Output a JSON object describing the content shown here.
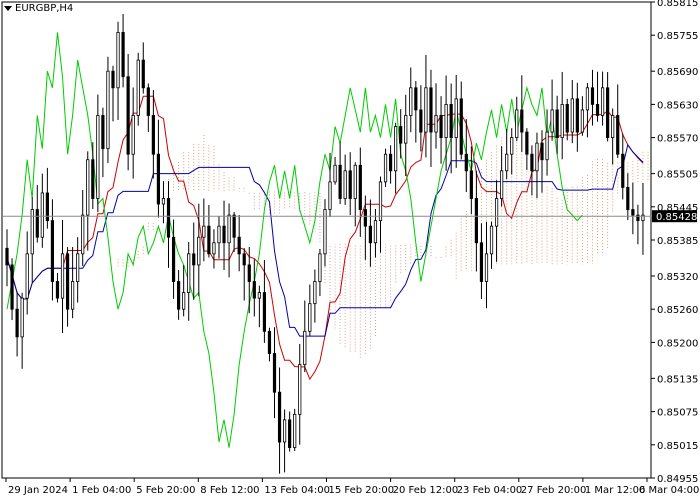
{
  "symbol_label": "EURGBP,H4",
  "icons": {
    "menu": "triangle-down-icon"
  },
  "colors": {
    "candle": "#000000",
    "tenkan": "#cc0000",
    "kijun": "#0000aa",
    "chikou": "#00cc00",
    "kumo_up": "#d9a0a0",
    "kumo_dn": "#e0a070",
    "price_line": "#8a8a8a"
  },
  "current_price": {
    "value": 0.85428,
    "label": "0.85428"
  },
  "chart_data": {
    "type": "candlestick",
    "ylim": [
      0.84955,
      0.85815
    ],
    "y_ticks": [
      "0.85815",
      "0.85755",
      "0.85690",
      "0.85630",
      "0.85570",
      "0.85505",
      "0.85445",
      "0.85385",
      "0.85320",
      "0.85260",
      "0.85200",
      "0.85135",
      "0.85075",
      "0.85015",
      "0.84955"
    ],
    "x_ticks": [
      "29 Jan 2024",
      "1 Feb 04:00",
      "5 Feb 20:00",
      "8 Feb 12:00",
      "13 Feb 04:00",
      "15 Feb 20:00",
      "20 Feb 12:00",
      "23 Feb 04:00",
      "27 Feb 20:00",
      "1 Mar 12:00",
      "6 Mar 04:00"
    ],
    "closes": [
      0.8534,
      0.8526,
      0.8521,
      0.8528,
      0.8536,
      0.8544,
      0.8539,
      0.8547,
      0.8542,
      0.8531,
      0.8528,
      0.8536,
      0.8526,
      0.8531,
      0.8536,
      0.8543,
      0.8553,
      0.8546,
      0.8561,
      0.8555,
      0.8569,
      0.8566,
      0.8576,
      0.8568,
      0.8554,
      0.8561,
      0.8571,
      0.8566,
      0.8561,
      0.8554,
      0.8545,
      0.8546,
      0.8539,
      0.8531,
      0.8526,
      0.8529,
      0.8536,
      0.8534,
      0.8539,
      0.8541,
      0.8536,
      0.8538,
      0.8541,
      0.8538,
      0.8543,
      0.8539,
      0.8536,
      0.8534,
      0.8531,
      0.8528,
      0.8529,
      0.8522,
      0.8518,
      0.8511,
      0.8502,
      0.8506,
      0.8501,
      0.8507,
      0.8516,
      0.8522,
      0.8527,
      0.8531,
      0.8536,
      0.8544,
      0.8549,
      0.8552,
      0.8546,
      0.8551,
      0.8546,
      0.8552,
      0.8544,
      0.8541,
      0.8538,
      0.8542,
      0.8549,
      0.8554,
      0.8551,
      0.8559,
      0.8556,
      0.8561,
      0.8566,
      0.8562,
      0.8558,
      0.8566,
      0.8558,
      0.8561,
      0.8557,
      0.8563,
      0.8557,
      0.8564,
      0.8554,
      0.8551,
      0.8546,
      0.8538,
      0.8531,
      0.8536,
      0.8541,
      0.8546,
      0.8551,
      0.8554,
      0.8557,
      0.8562,
      0.8558,
      0.8554,
      0.8551,
      0.8556,
      0.8553,
      0.8558,
      0.8562,
      0.8557,
      0.8563,
      0.8558,
      0.8564,
      0.8558,
      0.8562,
      0.8566,
      0.8563,
      0.8561,
      0.8566,
      0.8557,
      0.8561,
      0.8554,
      0.8548,
      0.8544,
      0.8543,
      0.8542,
      0.8543
    ]
  }
}
